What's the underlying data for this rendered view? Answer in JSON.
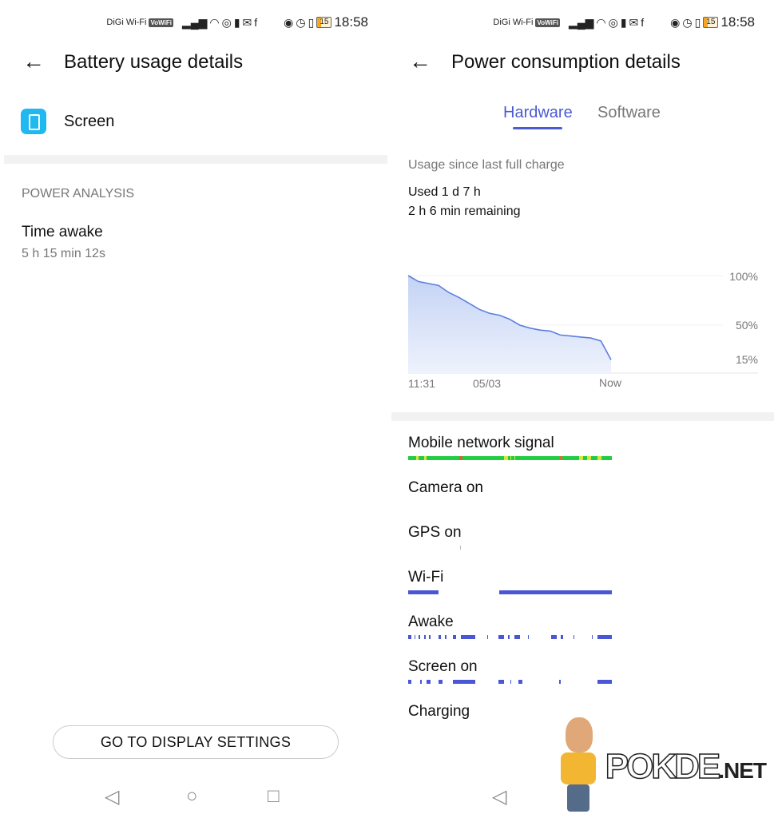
{
  "status_bar": {
    "carrier": "DiGi Wi-Fi",
    "vowifi_badge": "VoWiFi",
    "battery_level": "15",
    "time": "18:58"
  },
  "left": {
    "title": "Battery usage details",
    "app_name": "Screen",
    "section_header": "POWER ANALYSIS",
    "time_awake_label": "Time awake",
    "time_awake_value": "5 h 15 min 12s",
    "button_label": "GO TO DISPLAY SETTINGS"
  },
  "right": {
    "title": "Power consumption details",
    "tabs": [
      {
        "label": "Hardware",
        "active": true
      },
      {
        "label": "Software",
        "active": false
      }
    ],
    "usage_header": "Usage since last full charge",
    "used": "Used 1 d 7 h",
    "remaining": "2 h 6 min remaining",
    "timelines": [
      {
        "label": "Mobile network signal",
        "color": "#22cc44",
        "segments": [
          [
            0,
            1,
            "#22cc44"
          ],
          [
            0.04,
            0.05,
            "#d8e83a"
          ],
          [
            0.08,
            0.09,
            "#d8e83a"
          ],
          [
            0.25,
            0.265,
            "#e0602a"
          ],
          [
            0.47,
            0.49,
            "#d8e83a"
          ],
          [
            0.5,
            0.505,
            "#d8e83a"
          ],
          [
            0.52,
            0.525,
            "#d8e83a"
          ],
          [
            0.745,
            0.755,
            "#e06a2a"
          ],
          [
            0.84,
            0.86,
            "#d8e83a"
          ],
          [
            0.88,
            0.9,
            "#d8e83a"
          ],
          [
            0.93,
            0.95,
            "#d8e83a"
          ]
        ]
      },
      {
        "label": "Camera on",
        "segments": []
      },
      {
        "label": "GPS on",
        "segments": [
          [
            0.253,
            0.258,
            "#bbbbbb"
          ]
        ]
      },
      {
        "label": "Wi-Fi",
        "segments": [
          [
            0,
            0.15,
            "#4a56d6"
          ],
          [
            0.447,
            1,
            "#4a56d6"
          ]
        ]
      },
      {
        "label": "Awake",
        "segments": [
          [
            0,
            0.015,
            "#4a56d6"
          ],
          [
            0.03,
            0.035,
            "#4a56d6"
          ],
          [
            0.05,
            0.06,
            "#4a56d6"
          ],
          [
            0.08,
            0.085,
            "#4a56d6"
          ],
          [
            0.1,
            0.11,
            "#4a56d6"
          ],
          [
            0.15,
            0.16,
            "#4a56d6"
          ],
          [
            0.18,
            0.19,
            "#4a56d6"
          ],
          [
            0.22,
            0.235,
            "#4a56d6"
          ],
          [
            0.26,
            0.33,
            "#4a56d6"
          ],
          [
            0.39,
            0.393,
            "#4a56d6"
          ],
          [
            0.445,
            0.47,
            "#4a56d6"
          ],
          [
            0.49,
            0.5,
            "#4a56d6"
          ],
          [
            0.52,
            0.55,
            "#4a56d6"
          ],
          [
            0.59,
            0.593,
            "#4a56d6"
          ],
          [
            0.7,
            0.73,
            "#4a56d6"
          ],
          [
            0.75,
            0.76,
            "#4a56d6"
          ],
          [
            0.81,
            0.813,
            "#4a56d6"
          ],
          [
            0.9,
            0.905,
            "#4a56d6"
          ],
          [
            0.93,
            1,
            "#4a56d6"
          ]
        ]
      },
      {
        "label": "Screen on",
        "segments": [
          [
            0,
            0.015,
            "#4a56d6"
          ],
          [
            0.06,
            0.065,
            "#4a56d6"
          ],
          [
            0.09,
            0.11,
            "#4a56d6"
          ],
          [
            0.15,
            0.17,
            "#4a56d6"
          ],
          [
            0.22,
            0.33,
            "#4a56d6"
          ],
          [
            0.445,
            0.47,
            "#4a56d6"
          ],
          [
            0.5,
            0.505,
            "#4a56d6"
          ],
          [
            0.54,
            0.56,
            "#4a56d6"
          ],
          [
            0.74,
            0.75,
            "#4a56d6"
          ],
          [
            0.93,
            1,
            "#4a56d6"
          ]
        ]
      },
      {
        "label": "Charging",
        "segments": []
      }
    ]
  },
  "chart_data": {
    "type": "area",
    "xlabel": "",
    "ylabel": "",
    "x_tick_labels": [
      "11:31",
      "05/03",
      "Now"
    ],
    "y_tick_labels": [
      "100%",
      "50%",
      "15%"
    ],
    "ylim": [
      0,
      100
    ],
    "grid": true,
    "color": "#5b7fdc",
    "values": [
      100,
      94,
      92,
      90,
      83,
      78,
      72,
      66,
      62,
      60,
      56,
      50,
      47,
      45,
      44,
      40,
      39,
      38,
      37,
      34,
      15
    ]
  },
  "watermark": "POKDE.NET",
  "icons": [
    "back-arrow-icon",
    "screen-app-icon",
    "nav-back-icon",
    "nav-home-icon",
    "nav-recents-icon"
  ]
}
